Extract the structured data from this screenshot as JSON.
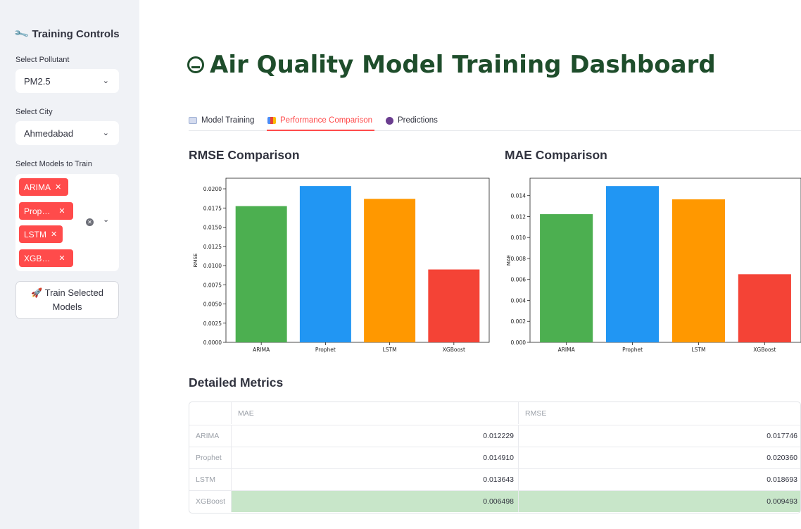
{
  "sidebar": {
    "title": "Training Controls",
    "pollutant_label": "Select Pollutant",
    "pollutant_value": "PM2.5",
    "city_label": "Select City",
    "city_value": "Ahmedabad",
    "models_label": "Select Models to Train",
    "model_tags": [
      "ARIMA",
      "Prop…",
      "LSTM",
      "XGB…"
    ],
    "train_button": [
      "Train Selected",
      "Models"
    ]
  },
  "main": {
    "title": "Air Quality Model Training Dashboard",
    "tabs": [
      {
        "label": "Model Training",
        "icon": "chart-line-icon",
        "active": false
      },
      {
        "label": "Performance Comparison",
        "icon": "bar-chart-icon",
        "active": true
      },
      {
        "label": "Predictions",
        "icon": "crystal-ball-icon",
        "active": false
      }
    ],
    "rmse_heading": "RMSE Comparison",
    "mae_heading": "MAE Comparison",
    "detailed_heading": "Detailed Metrics"
  },
  "chart_data": [
    {
      "type": "bar",
      "title": "",
      "categories": [
        "ARIMA",
        "Prophet",
        "LSTM",
        "XGBoost"
      ],
      "values": [
        0.017746,
        0.02036,
        0.018693,
        0.009493
      ],
      "colors": [
        "#4caf50",
        "#2196f3",
        "#ff9800",
        "#f44336"
      ],
      "ylabel": "RMSE",
      "ylim": [
        0,
        0.02138
      ],
      "yticks": [
        "0.0000",
        "0.0025",
        "0.0050",
        "0.0075",
        "0.0100",
        "0.0125",
        "0.0150",
        "0.0175",
        "0.0200"
      ],
      "ytick_values": [
        0,
        0.0025,
        0.005,
        0.0075,
        0.01,
        0.0125,
        0.015,
        0.0175,
        0.02
      ]
    },
    {
      "type": "bar",
      "title": "",
      "categories": [
        "ARIMA",
        "Prophet",
        "LSTM",
        "XGBoost"
      ],
      "values": [
        0.012229,
        0.01491,
        0.013643,
        0.006498
      ],
      "colors": [
        "#4caf50",
        "#2196f3",
        "#ff9800",
        "#f44336"
      ],
      "ylabel": "MAE",
      "ylim": [
        0,
        0.01566
      ],
      "yticks": [
        "0.000",
        "0.002",
        "0.004",
        "0.006",
        "0.008",
        "0.010",
        "0.012",
        "0.014"
      ],
      "ytick_values": [
        0,
        0.002,
        0.004,
        0.006,
        0.008,
        0.01,
        0.012,
        0.014
      ]
    }
  ],
  "metrics_table": {
    "columns": [
      "MAE",
      "RMSE"
    ],
    "rows": [
      {
        "model": "ARIMA",
        "mae": "0.012229",
        "rmse": "0.017746"
      },
      {
        "model": "Prophet",
        "mae": "0.014910",
        "rmse": "0.020360"
      },
      {
        "model": "LSTM",
        "mae": "0.013643",
        "rmse": "0.018693"
      },
      {
        "model": "XGBoost",
        "mae": "0.006498",
        "rmse": "0.009493"
      }
    ],
    "highlight_color": "#c8e6c9"
  }
}
